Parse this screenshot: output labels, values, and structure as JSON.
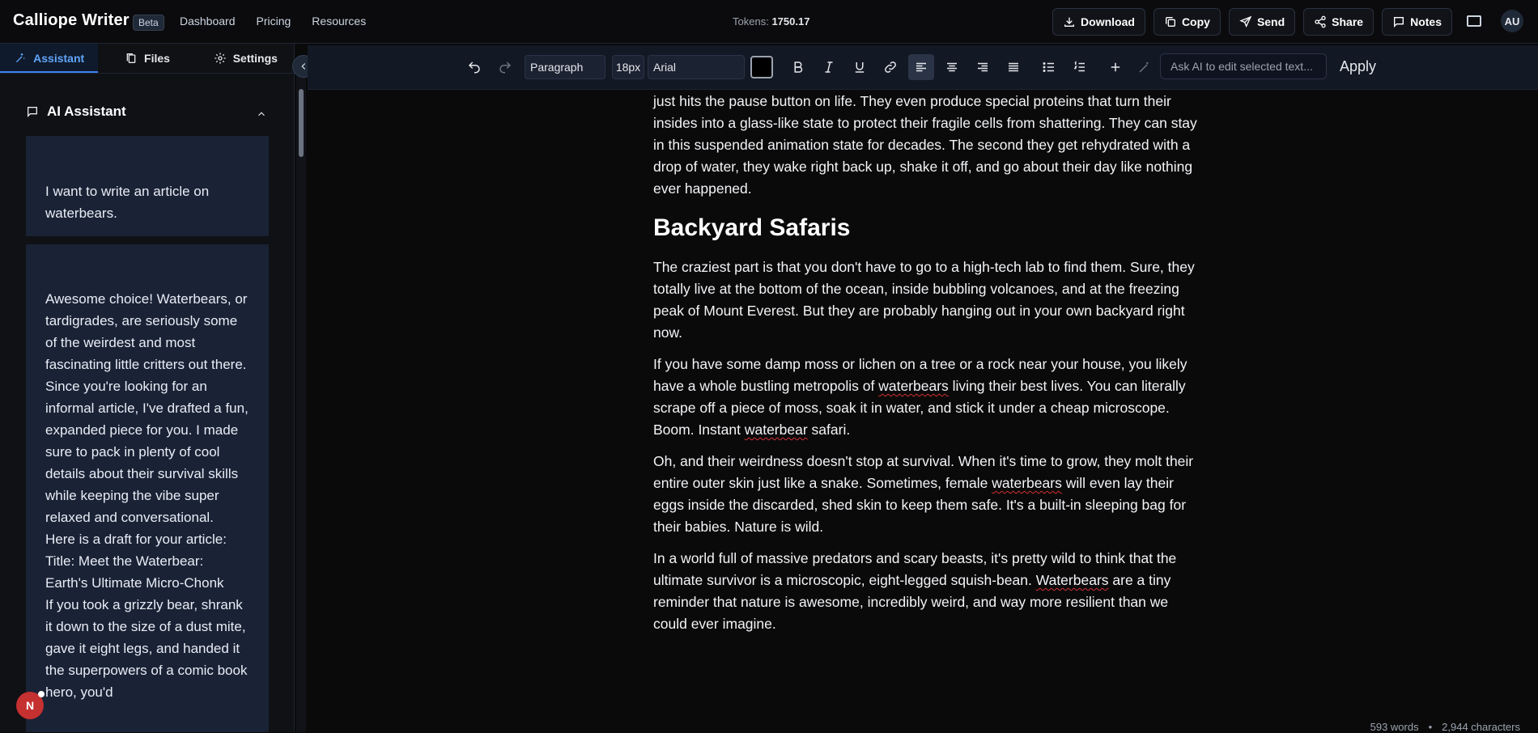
{
  "app": {
    "name": "Calliope Writer",
    "badge": "Beta",
    "nav": [
      "Dashboard",
      "Pricing",
      "Resources"
    ],
    "tokens_label": "Tokens:",
    "tokens_value": "1750.17",
    "actions": [
      "Download",
      "Copy",
      "Send",
      "Share",
      "Notes"
    ],
    "avatar": "AU"
  },
  "sidebar": {
    "tabs": [
      {
        "label": "Assistant",
        "icon": "sparkle-icon",
        "active": true
      },
      {
        "label": "Files",
        "icon": "files-icon",
        "active": false
      },
      {
        "label": "Settings",
        "icon": "gear-icon",
        "active": false
      }
    ],
    "section_title": "AI Assistant",
    "messages": [
      {
        "role": "user",
        "text": "I want to write an article on waterbears."
      },
      {
        "role": "assistant",
        "lines": [
          "Awesome choice! Waterbears, or tardigrades, are seriously some of the weirdest and most fascinating little critters out there. Since you're looking for an informal article, I've drafted a fun, expanded piece for you. I made sure to pack in plenty of cool details about their survival skills while keeping the vibe super relaxed and conversational.",
          "Here is a draft for your article:",
          "Title: Meet the Waterbear: Earth's Ultimate Micro-Chonk",
          "If you took a grizzly bear, shrank it down to the size of a dust mite, gave it eight legs, and handed it the superpowers of a comic book hero, you'd"
        ]
      }
    ],
    "notification_badge": "N"
  },
  "toolbar": {
    "block_type": "Paragraph",
    "font_size": "18px",
    "font_family": "Arial",
    "text_color": "#000000",
    "ask_ai_placeholder": "Ask AI to edit selected text...",
    "apply_label": "Apply"
  },
  "document": {
    "p0": "It pulls in its legs, shuts down its metabolism to less than one percent of normal, and just hits the pause button on life. They even produce special proteins that turn their insides into a glass-like state to protect their fragile cells from shattering. They can stay in this suspended animation state for decades. The second they get rehydrated with a drop of water, they wake right back up, shake it off, and go about their day like nothing ever happened.",
    "heading": "Backyard Safaris",
    "p1": "The craziest part is that you don't have to go to a high-tech lab to find them. Sure, they totally live at the bottom of the ocean, inside bubbling volcanoes, and at the freezing peak of Mount Everest. But they are probably hanging out in your own backyard right now.",
    "p2_a": "If you have some damp moss or lichen on a tree or a rock near your house, you likely have a whole bustling metropolis of ",
    "p2_b": "waterbears",
    "p2_c": " living their best lives. You can literally scrape off a piece of moss, soak it in water, and stick it under a cheap microscope. Boom. Instant ",
    "p2_d": "waterbear",
    "p2_e": " safari.",
    "p3_a": "Oh, and their weirdness doesn't stop at survival. When it's time to grow, they molt their entire outer skin just like a snake. Sometimes, female ",
    "p3_b": "waterbears",
    "p3_c": " will even lay their eggs inside the discarded, shed skin to keep them safe. It's a built-in sleeping bag for their babies. Nature is wild.",
    "p4_a": "In a world full of massive predators and scary beasts, it's pretty wild to think that the ultimate survivor is a microscopic, eight-legged squish-bean. ",
    "p4_b": "Waterbears",
    "p4_c": " are a tiny reminder that nature is awesome, incredibly weird, and way more resilient than we could ever imagine."
  },
  "footer": {
    "words": "593 words",
    "separator": "•",
    "chars": "2,944 characters"
  }
}
